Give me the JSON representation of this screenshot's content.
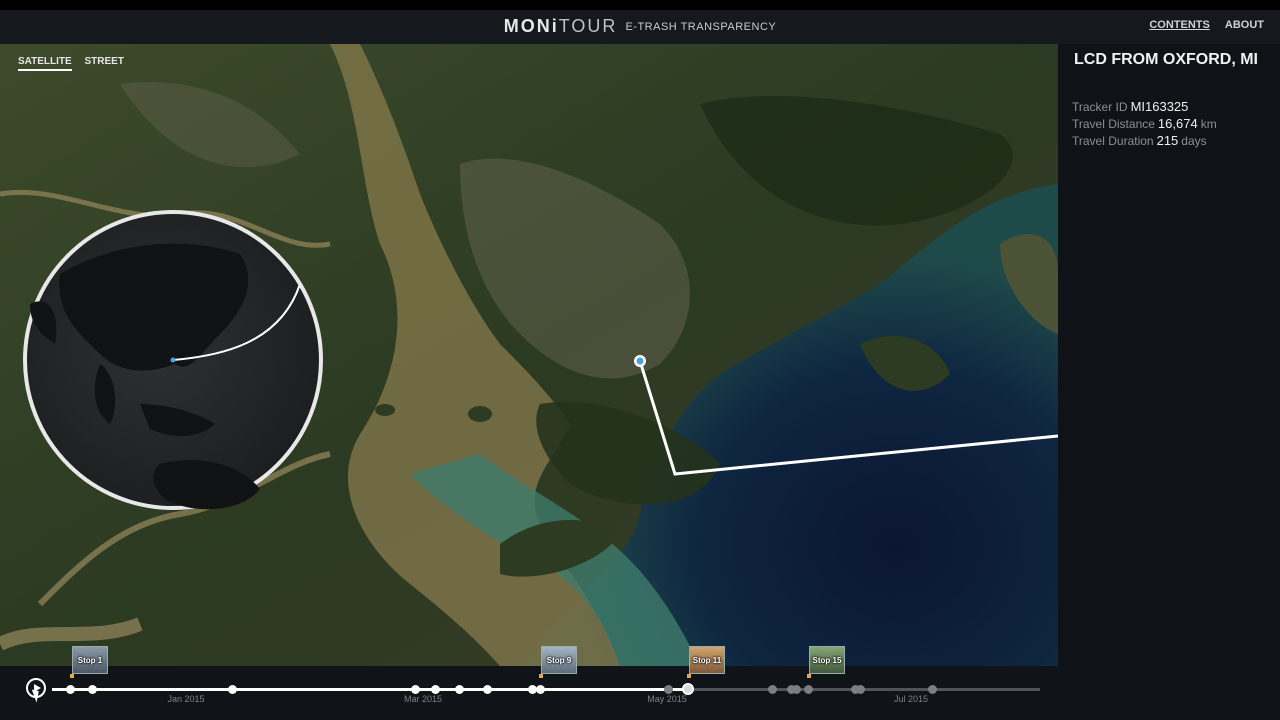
{
  "header": {
    "logo_bold": "MONi",
    "logo_light": "TOUR",
    "tagline": "E-TRASH TRANSPARENCY",
    "nav": [
      {
        "label": "CONTENTS",
        "active": true
      },
      {
        "label": "ABOUT",
        "active": false
      }
    ]
  },
  "map": {
    "layers": [
      {
        "label": "SATELLITE",
        "active": true
      },
      {
        "label": "STREET",
        "active": false
      }
    ],
    "colors": {
      "route": "#ffffff",
      "marker": "#4aa3df",
      "sea": "#0d1c38"
    }
  },
  "item": {
    "title": "LCD FROM OXFORD, MI",
    "tracker_id_label": "Tracker ID",
    "tracker_id": "MI163325",
    "distance_label": "Travel Distance",
    "distance": "16,674",
    "distance_unit": "km",
    "duration_label": "Travel Duration",
    "duration": "215",
    "duration_unit": "days"
  },
  "timeline": {
    "months": [
      "Jan 2015",
      "Mar 2015",
      "May 2015",
      "Jul 2015"
    ],
    "stops": [
      {
        "label": "Stop 1"
      },
      {
        "label": "Stop 9"
      },
      {
        "label": "Stop 11"
      },
      {
        "label": "Stop 15"
      }
    ]
  }
}
